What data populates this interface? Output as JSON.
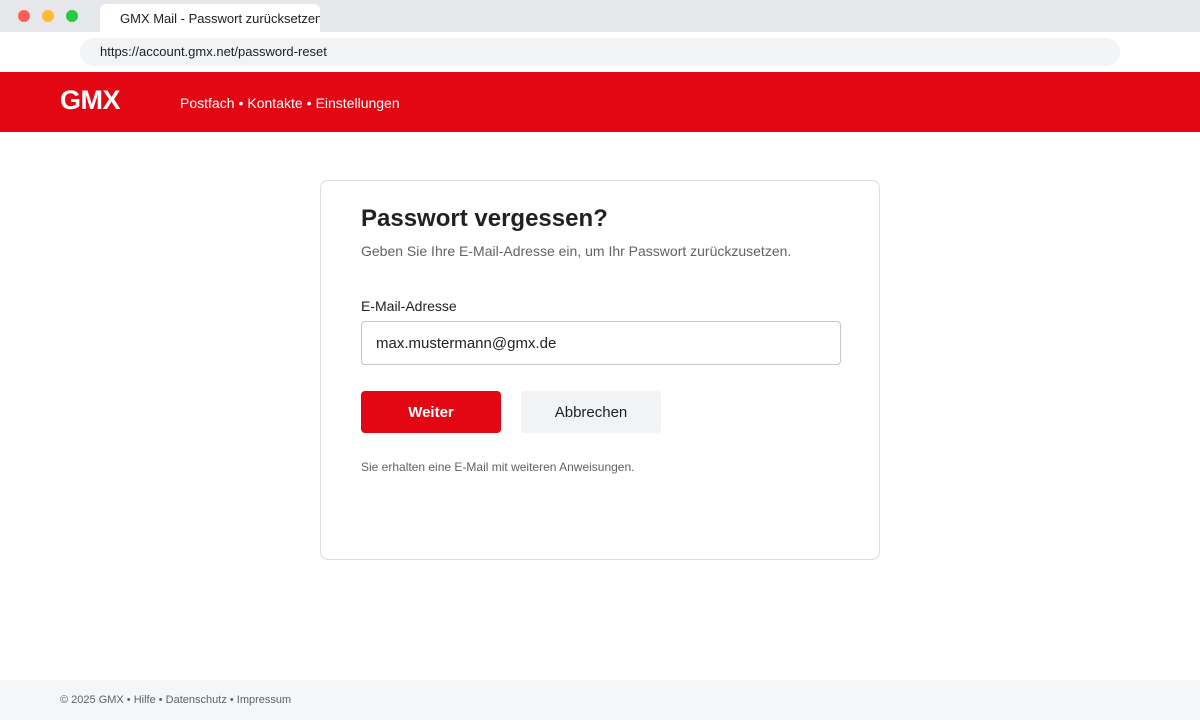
{
  "browser": {
    "tab_title": "GMX Mail - Passwort zurücksetzen",
    "url": "https://account.gmx.net/password-reset"
  },
  "header": {
    "logo": "GMX",
    "nav": [
      "Postfach",
      "Kontakte",
      "Einstellungen"
    ],
    "nav_separator": "•",
    "brand_color": "#e30613"
  },
  "form": {
    "title": "Passwort vergessen?",
    "subtitle": "Geben Sie Ihre E-Mail-Adresse ein, um Ihr Passwort zurückzusetzen.",
    "email_label": "E-Mail-Adresse",
    "email_value": "max.mustermann@gmx.de",
    "submit_label": "Weiter",
    "cancel_label": "Abbrechen",
    "hint": "Sie erhalten eine E-Mail mit weiteren Anweisungen."
  },
  "footer": {
    "text": "© 2025 GMX • Hilfe • Datenschutz • Impressum"
  }
}
